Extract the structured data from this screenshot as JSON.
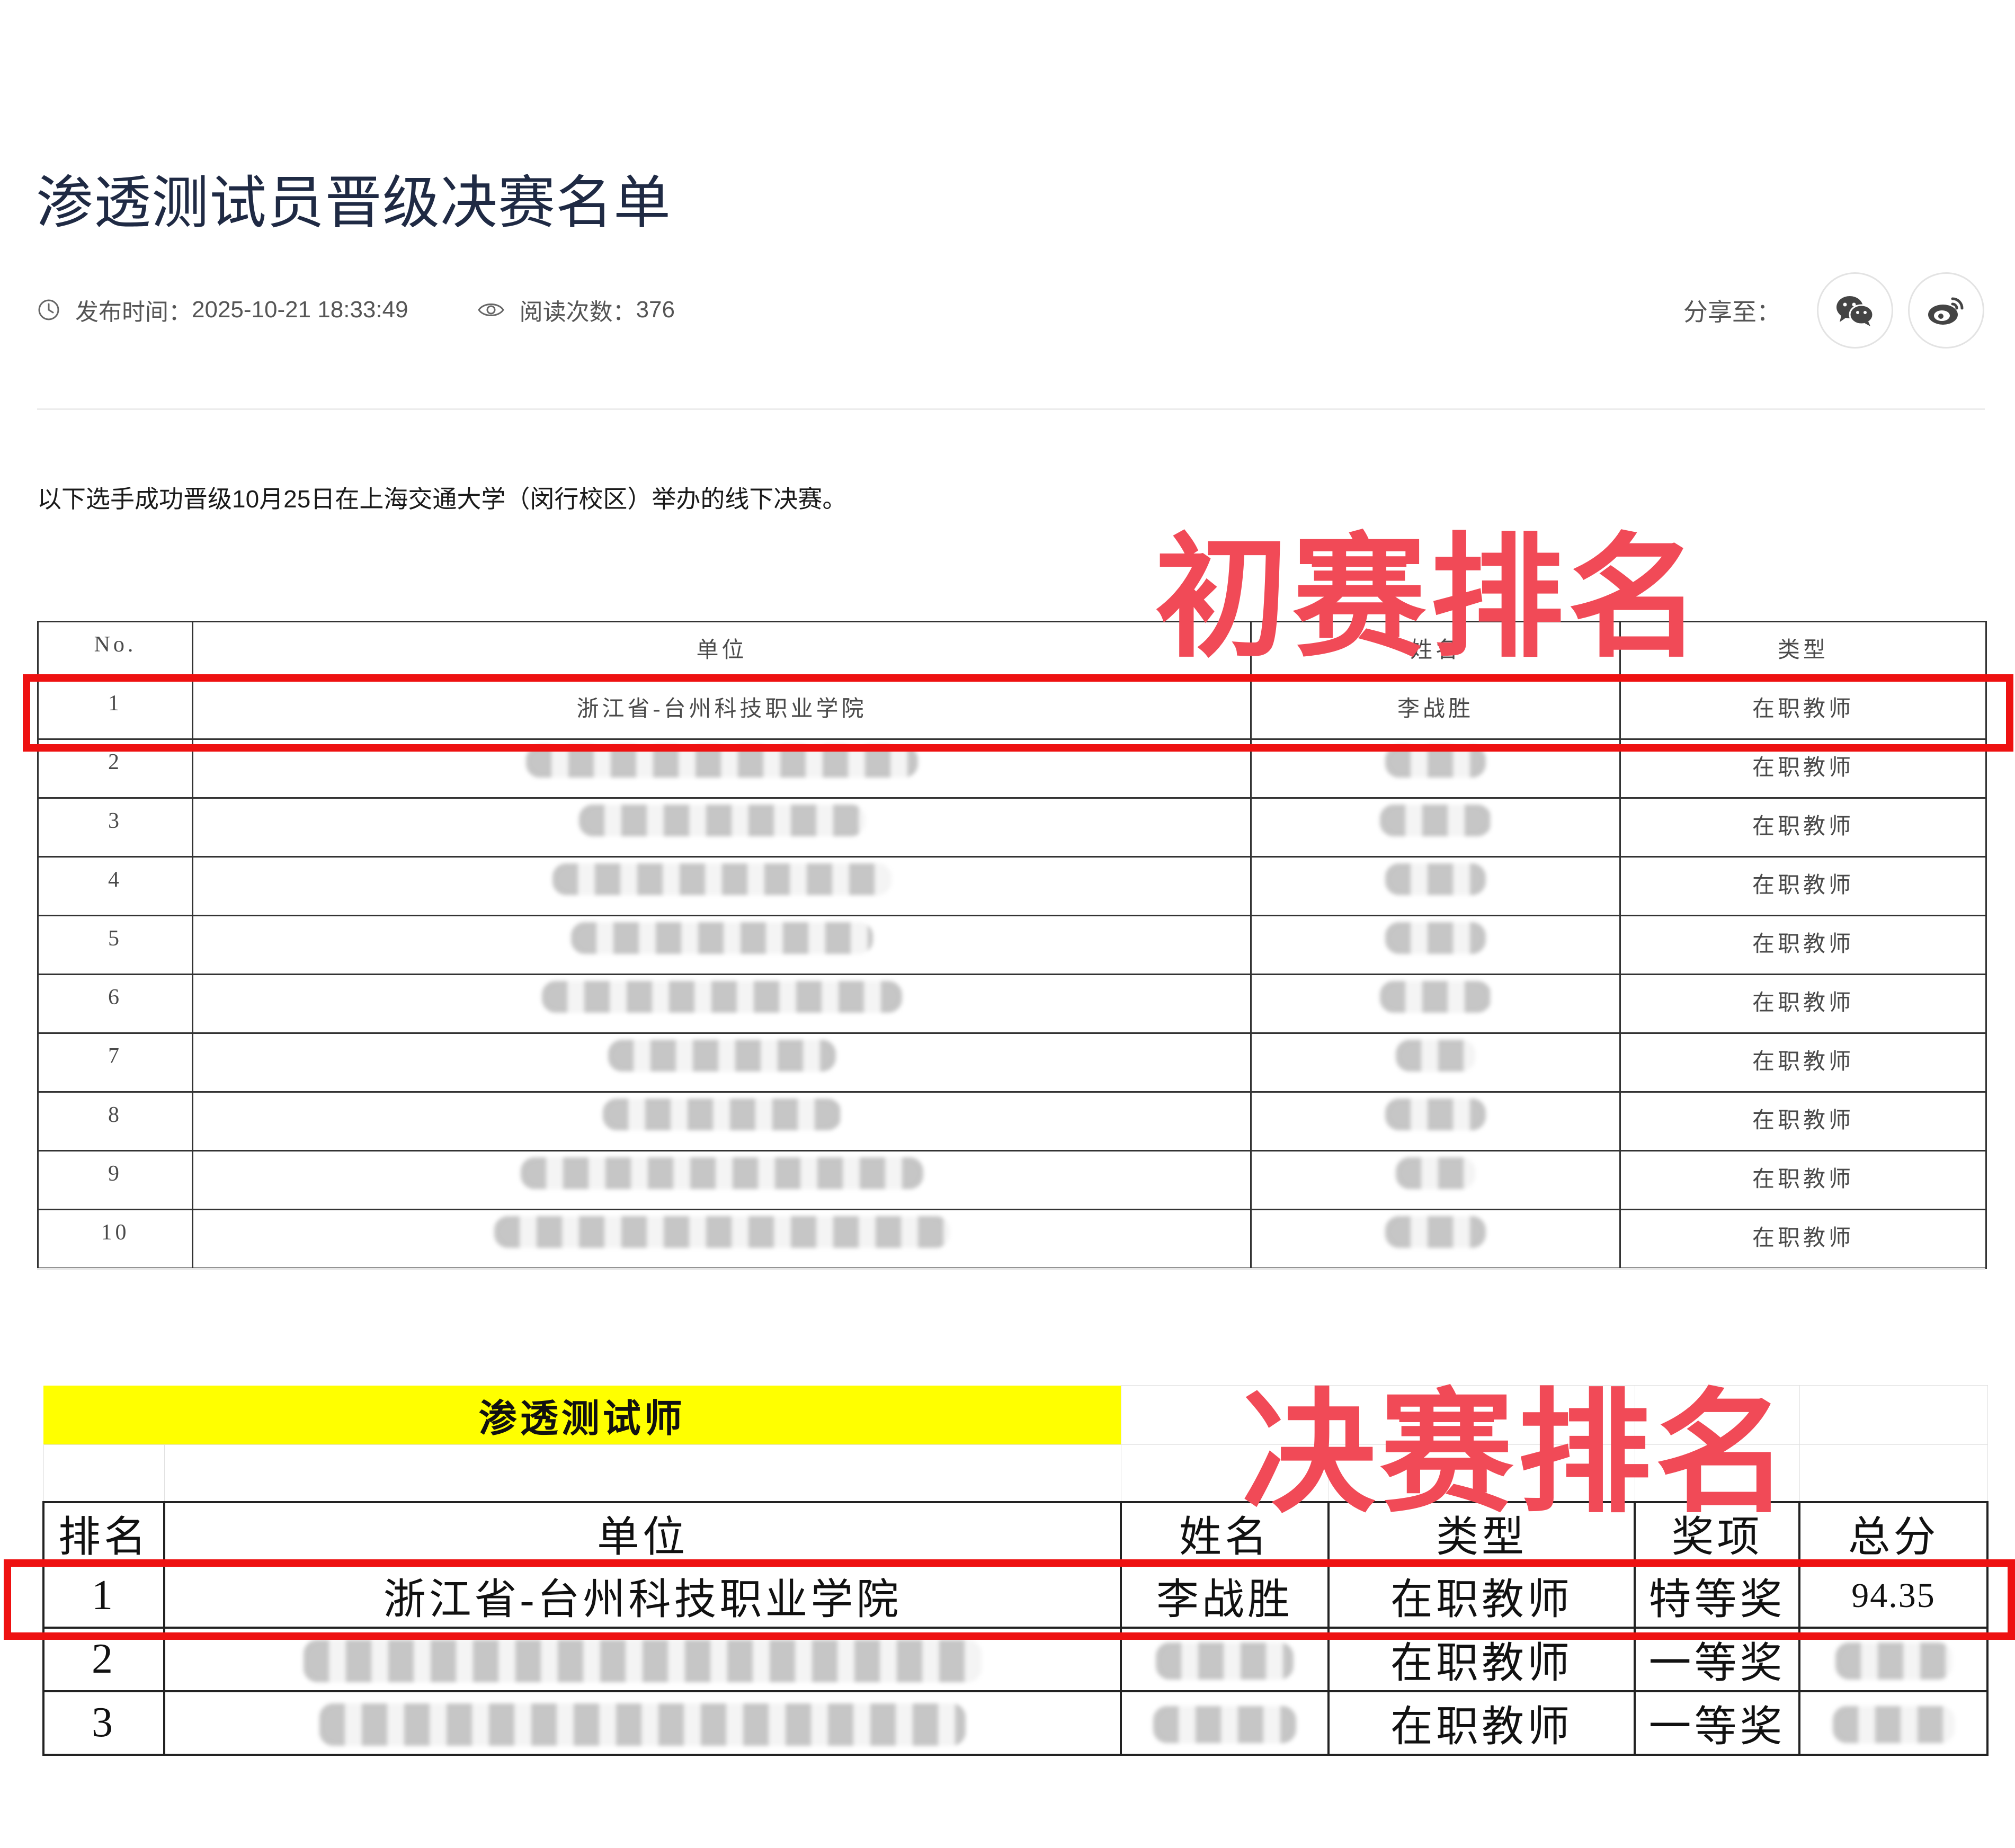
{
  "article": {
    "title": "渗透测试员晋级决赛名单",
    "publish_label": "发布时间：",
    "publish_time": "2025-10-21 18:33:49",
    "views_label": "阅读次数：",
    "views": "376",
    "share_label": "分享至：",
    "intro": "以下选手成功晋级10月25日在上海交通大学（闵行校区）举办的线下决赛。"
  },
  "icons": [
    "clock-icon",
    "eye-icon",
    "wechat-icon",
    "weibo-icon"
  ],
  "overlay": {
    "preliminary_label": "初赛排名",
    "final_label": "决赛排名",
    "label_color": "#f14a57",
    "box_color": "#ee1111"
  },
  "table1": {
    "headers": [
      "No.",
      "单位",
      "姓名",
      "类型"
    ],
    "rows": [
      {
        "no": "1",
        "unit": "浙江省-台州科技职业学院",
        "name": "李战胜",
        "type": "在职教师"
      },
      {
        "no": "2",
        "unit": "",
        "name": "",
        "type": "在职教师"
      },
      {
        "no": "3",
        "unit": "",
        "name": "",
        "type": "在职教师"
      },
      {
        "no": "4",
        "unit": "",
        "name": "",
        "type": "在职教师"
      },
      {
        "no": "5",
        "unit": "",
        "name": "",
        "type": "在职教师"
      },
      {
        "no": "6",
        "unit": "",
        "name": "",
        "type": "在职教师"
      },
      {
        "no": "7",
        "unit": "",
        "name": "",
        "type": "在职教师"
      },
      {
        "no": "8",
        "unit": "",
        "name": "",
        "type": "在职教师"
      },
      {
        "no": "9",
        "unit": "",
        "name": "",
        "type": "在职教师"
      },
      {
        "no": "10",
        "unit": "",
        "name": "",
        "type": "在职教师"
      }
    ]
  },
  "table2": {
    "title": "渗透测试师",
    "title_bg": "#ffff00",
    "headers": [
      "排名",
      "单位",
      "姓名",
      "类型",
      "奖项",
      "总分"
    ],
    "rows": [
      {
        "rank": "1",
        "unit": "浙江省-台州科技职业学院",
        "name": "李战胜",
        "type": "在职教师",
        "award": "特等奖",
        "score": "94.35"
      },
      {
        "rank": "2",
        "unit": "",
        "name": "",
        "type": "在职教师",
        "award": "一等奖",
        "score": ""
      },
      {
        "rank": "3",
        "unit": "",
        "name": "",
        "type": "在职教师",
        "award": "一等奖",
        "score": ""
      }
    ]
  }
}
